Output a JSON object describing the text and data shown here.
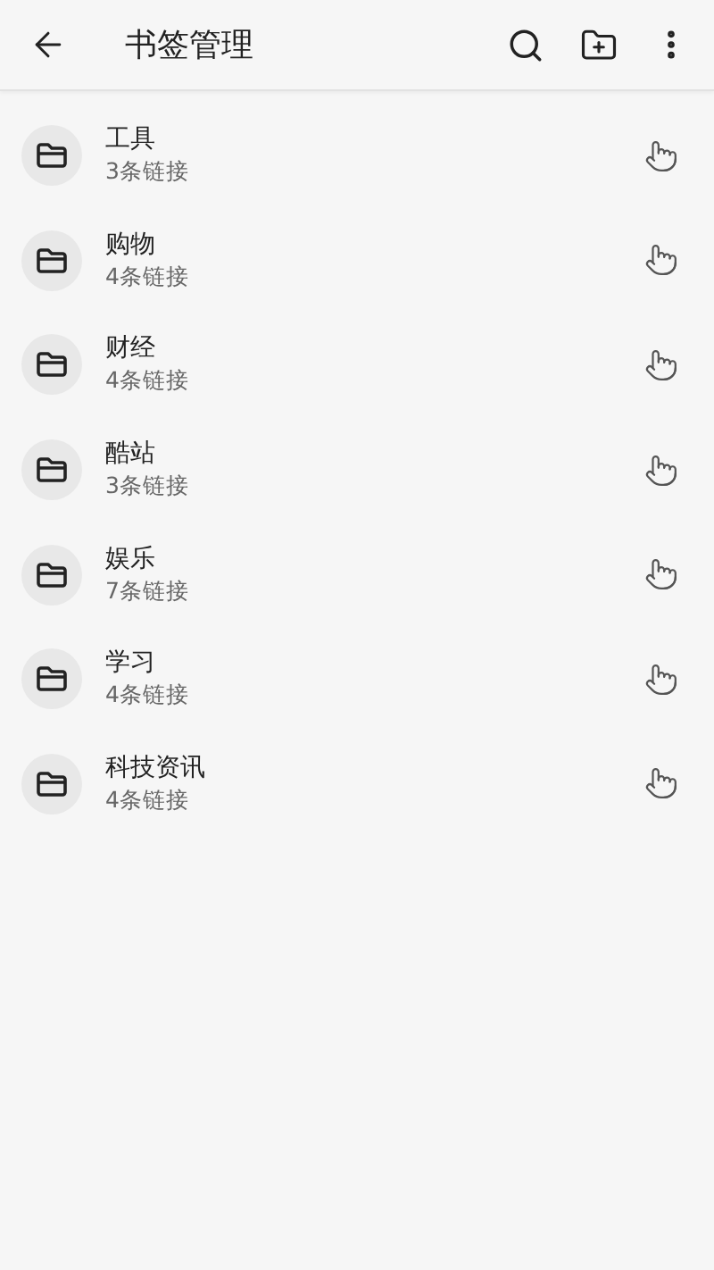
{
  "header": {
    "title": "书签管理"
  },
  "folders": [
    {
      "name": "工具",
      "count": "3条链接"
    },
    {
      "name": "购物",
      "count": "4条链接"
    },
    {
      "name": "财经",
      "count": "4条链接"
    },
    {
      "name": "酷站",
      "count": "3条链接"
    },
    {
      "name": "娱乐",
      "count": "7条链接"
    },
    {
      "name": "学习",
      "count": "4条链接"
    },
    {
      "name": "科技资讯",
      "count": "4条链接"
    }
  ]
}
